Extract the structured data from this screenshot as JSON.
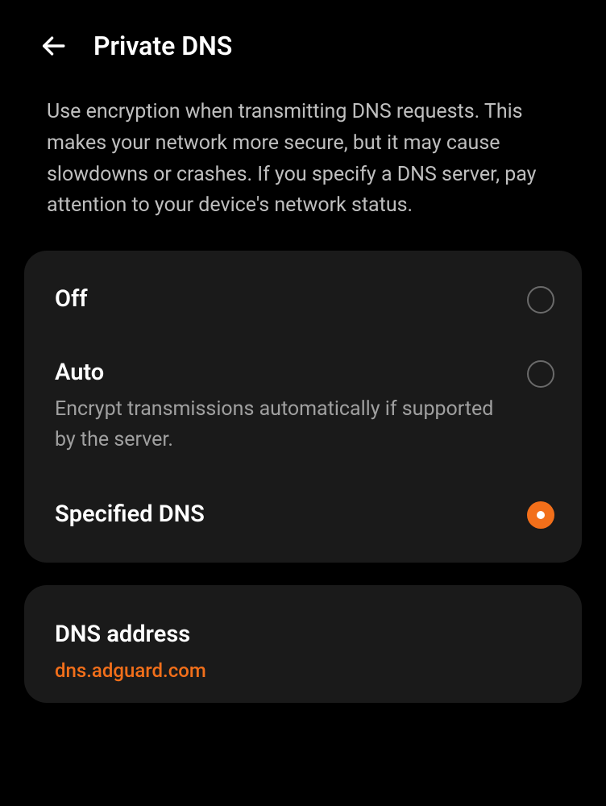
{
  "header": {
    "title": "Private DNS"
  },
  "description": "Use encryption when transmitting DNS requests. This makes your network more secure, but it may cause slowdowns or crashes. If you specify a DNS server, pay attention to your device's network status.",
  "options": {
    "off": {
      "title": "Off",
      "selected": false
    },
    "auto": {
      "title": "Auto",
      "subtitle": "Encrypt transmissions automatically if supported by the server.",
      "selected": false
    },
    "specified": {
      "title": "Specified DNS",
      "selected": true
    }
  },
  "dns_section": {
    "title": "DNS address",
    "address": "dns.adguard.com"
  },
  "colors": {
    "accent": "#f26f1a",
    "card_bg": "#1a1a1a"
  }
}
